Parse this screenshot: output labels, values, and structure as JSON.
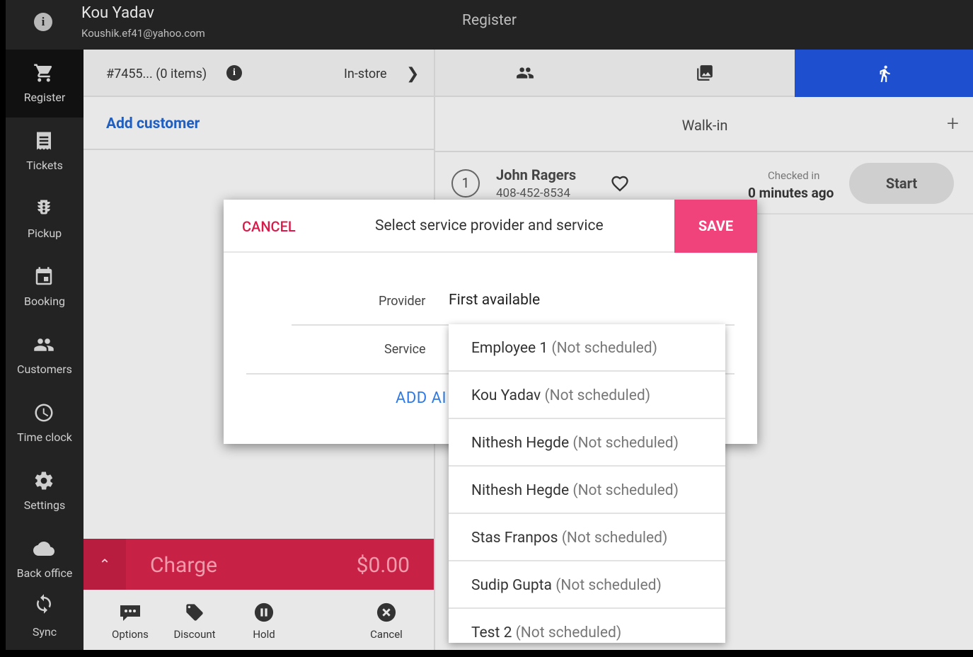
{
  "header": {
    "user_name": "Kou Yadav",
    "user_email": "Koushik.ef41@yahoo.com",
    "title": "Register"
  },
  "sidebar": {
    "items": [
      {
        "label": "Register",
        "icon": "cart-icon"
      },
      {
        "label": "Tickets",
        "icon": "receipt-icon"
      },
      {
        "label": "Pickup",
        "icon": "traffic-light-icon"
      },
      {
        "label": "Booking",
        "icon": "calendar-icon"
      },
      {
        "label": "Customers",
        "icon": "people-icon"
      },
      {
        "label": "Time clock",
        "icon": "clock-icon"
      },
      {
        "label": "Settings",
        "icon": "gear-icon"
      },
      {
        "label": "Back office",
        "icon": "cloud-icon"
      },
      {
        "label": "Sync",
        "icon": "sync-icon"
      }
    ]
  },
  "cart": {
    "ticket_label": "#7455... (0 items)",
    "order_type": "In-store",
    "add_customer": "Add customer",
    "charge_label": "Charge",
    "charge_amount": "$0.00",
    "actions": [
      {
        "label": "Options"
      },
      {
        "label": "Discount"
      },
      {
        "label": "Hold"
      },
      {
        "label": "Cancel"
      }
    ]
  },
  "queue": {
    "section_title": "Walk-in",
    "entries": [
      {
        "position": "1",
        "name": "John Ragers",
        "phone": "408-452-8534",
        "checked_in_label": "Checked in",
        "checked_in_time": "0 minutes ago",
        "action": "Start"
      }
    ]
  },
  "modal": {
    "cancel_label": "CANCEL",
    "title": "Select service provider and service",
    "save_label": "SAVE",
    "provider_label": "Provider",
    "provider_value": "First available",
    "service_label": "Service",
    "add_another_label": "ADD AI"
  },
  "dropdown": {
    "options": [
      {
        "name": "Employee 1",
        "status": "(Not scheduled)"
      },
      {
        "name": "Kou Yadav",
        "status": "(Not scheduled)"
      },
      {
        "name": "Nithesh Hegde",
        "status": "(Not scheduled)"
      },
      {
        "name": "Nithesh Hegde",
        "status": "(Not scheduled)"
      },
      {
        "name": "Stas Franpos",
        "status": "(Not scheduled)"
      },
      {
        "name": "Sudip Gupta",
        "status": "(Not scheduled)"
      },
      {
        "name": "Test 2",
        "status": "(Not scheduled)"
      }
    ]
  },
  "colors": {
    "accent_blue": "#1e4fcf",
    "charge_red": "#c72246",
    "save_pink": "#f0437c",
    "cancel_red": "#d81b4a"
  }
}
